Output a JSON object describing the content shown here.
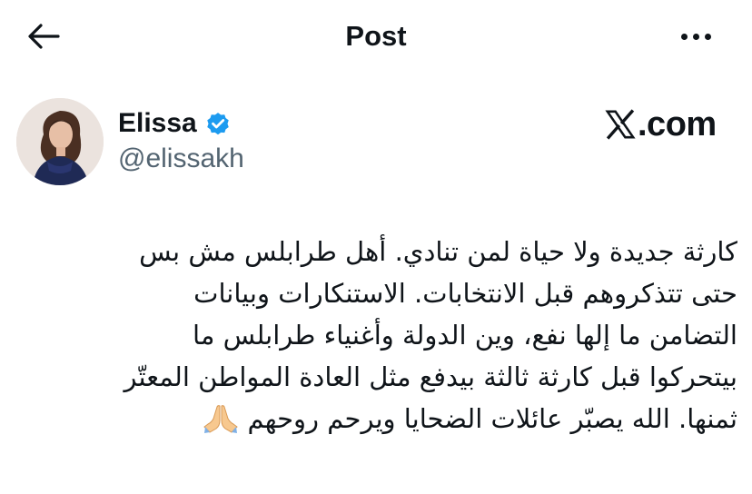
{
  "header": {
    "title": "Post",
    "back_icon": "arrow-left-icon",
    "more_icon": "more-horizontal-icon"
  },
  "author": {
    "name": "Elissa",
    "handle": "@elissakh",
    "verified": true,
    "verified_color": "#1d9bf0"
  },
  "brand": {
    "domain": ".com",
    "logo_icon": "x-logo-icon"
  },
  "tweet": {
    "lines": [
      "كارثة جديدة ولا حياة لمن تنادي. أهل طرابلس مش بس",
      "حتى تتذكروهم قبل الانتخابات. الاستنكارات وبيانات",
      "التضامن ما إلها نفع، وين الدولة وأغنياء طرابلس ما",
      "بيتحركوا قبل كارثة ثالثة بيدفع مثل العادة المواطن المعتّر",
      "ثمنها. الله يصبّر عائلات الضحايا ويرحم روحهم"
    ],
    "emoji_icon": "folded-hands-icon"
  }
}
